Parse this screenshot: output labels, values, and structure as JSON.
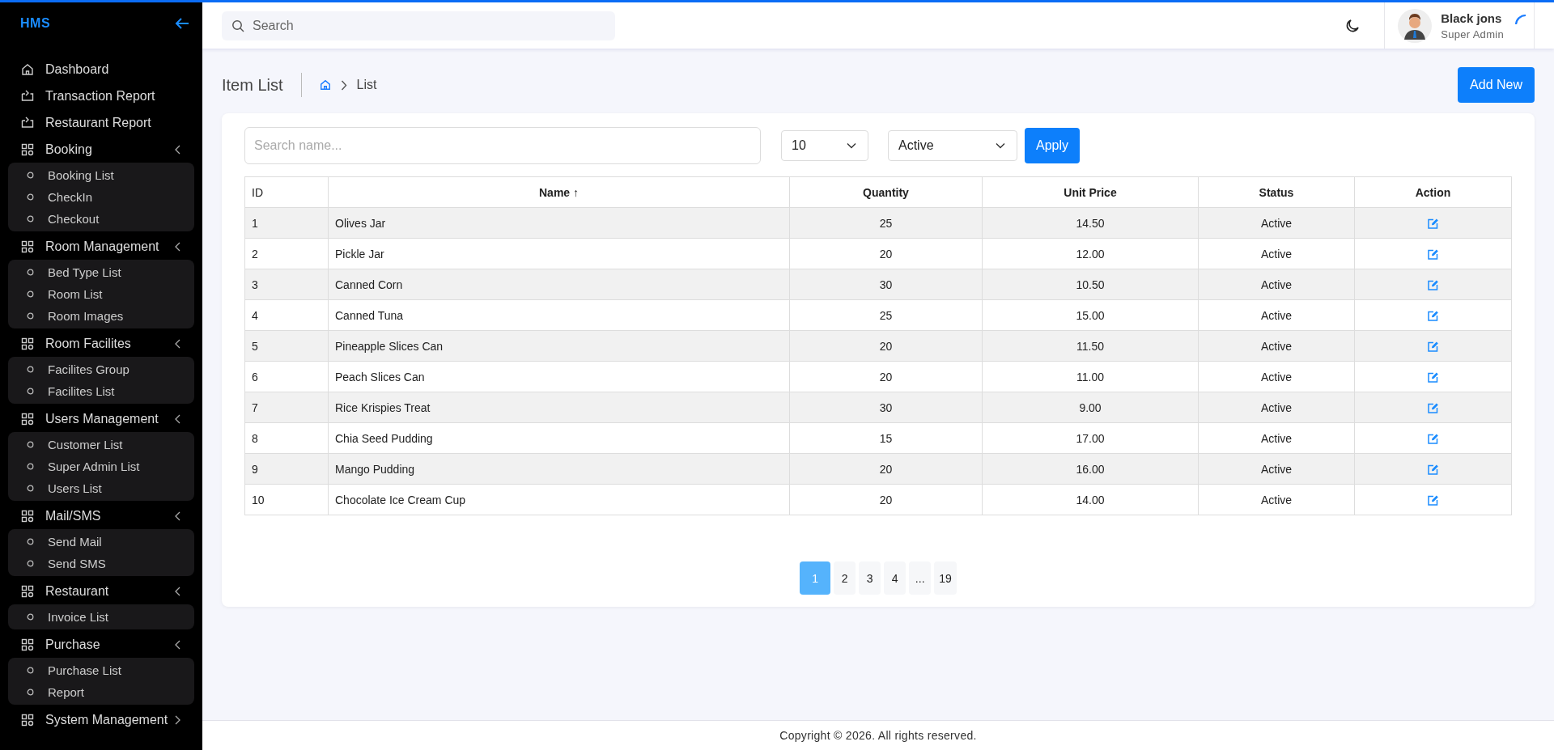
{
  "sidebar": {
    "logo": "HMS",
    "items": [
      {
        "kind": "link",
        "label": "Dashboard"
      },
      {
        "kind": "link",
        "label": "Transaction Report"
      },
      {
        "kind": "link",
        "label": "Restaurant Report"
      },
      {
        "kind": "group",
        "label": "Booking",
        "expanded": true,
        "children": [
          {
            "label": "Booking List"
          },
          {
            "label": "CheckIn"
          },
          {
            "label": "Checkout"
          }
        ]
      },
      {
        "kind": "group",
        "label": "Room Management",
        "expanded": true,
        "children": [
          {
            "label": "Bed Type List"
          },
          {
            "label": "Room List"
          },
          {
            "label": "Room Images"
          }
        ]
      },
      {
        "kind": "group",
        "label": "Room Facilites",
        "expanded": true,
        "children": [
          {
            "label": "Facilites Group"
          },
          {
            "label": "Facilites List"
          }
        ]
      },
      {
        "kind": "group",
        "label": "Users Management",
        "expanded": true,
        "children": [
          {
            "label": "Customer List"
          },
          {
            "label": "Super Admin List"
          },
          {
            "label": "Users List"
          }
        ]
      },
      {
        "kind": "group",
        "label": "Mail/SMS",
        "expanded": true,
        "children": [
          {
            "label": "Send Mail"
          },
          {
            "label": "Send SMS"
          }
        ]
      },
      {
        "kind": "group",
        "label": "Restaurant",
        "expanded": true,
        "children": [
          {
            "label": "Invoice List"
          }
        ]
      },
      {
        "kind": "group",
        "label": "Purchase",
        "expanded": true,
        "children": [
          {
            "label": "Purchase List"
          },
          {
            "label": "Report"
          }
        ]
      },
      {
        "kind": "group",
        "label": "System Management",
        "expanded": false
      }
    ]
  },
  "header": {
    "search": {
      "placeholder": "Search"
    },
    "user": {
      "name": "Black jons",
      "role": "Super Admin"
    }
  },
  "page": {
    "title": "Item List",
    "breadcrumb": "List",
    "add_button": "Add New"
  },
  "filters": {
    "search": {
      "placeholder": "Search name..."
    },
    "per_page": "10",
    "status": "Active",
    "apply": "Apply"
  },
  "table": {
    "columns": [
      {
        "label": "ID"
      },
      {
        "label": "Name ↑"
      },
      {
        "label": "Quantity"
      },
      {
        "label": "Unit Price"
      },
      {
        "label": "Status"
      },
      {
        "label": "Action"
      }
    ],
    "rows": [
      {
        "id": "1",
        "name": "Olives Jar",
        "quantity": "25",
        "unit_price": "14.50",
        "status": "Active"
      },
      {
        "id": "2",
        "name": "Pickle Jar",
        "quantity": "20",
        "unit_price": "12.00",
        "status": "Active"
      },
      {
        "id": "3",
        "name": "Canned Corn",
        "quantity": "30",
        "unit_price": "10.50",
        "status": "Active"
      },
      {
        "id": "4",
        "name": "Canned Tuna",
        "quantity": "25",
        "unit_price": "15.00",
        "status": "Active"
      },
      {
        "id": "5",
        "name": "Pineapple Slices Can",
        "quantity": "20",
        "unit_price": "11.50",
        "status": "Active"
      },
      {
        "id": "6",
        "name": "Peach Slices Can",
        "quantity": "20",
        "unit_price": "11.00",
        "status": "Active"
      },
      {
        "id": "7",
        "name": "Rice Krispies Treat",
        "quantity": "30",
        "unit_price": "9.00",
        "status": "Active"
      },
      {
        "id": "8",
        "name": "Chia Seed Pudding",
        "quantity": "15",
        "unit_price": "17.00",
        "status": "Active"
      },
      {
        "id": "9",
        "name": "Mango Pudding",
        "quantity": "20",
        "unit_price": "16.00",
        "status": "Active"
      },
      {
        "id": "10",
        "name": "Chocolate Ice Cream Cup",
        "quantity": "20",
        "unit_price": "14.00",
        "status": "Active"
      }
    ]
  },
  "pagination": [
    {
      "label": "1",
      "selected": true
    },
    {
      "label": "2",
      "selected": false
    },
    {
      "label": "3",
      "selected": false
    },
    {
      "label": "4",
      "selected": false
    },
    {
      "label": "...",
      "selected": false
    },
    {
      "label": "19",
      "selected": false
    }
  ],
  "footer": "Copyright © 2026. All rights reserved."
}
